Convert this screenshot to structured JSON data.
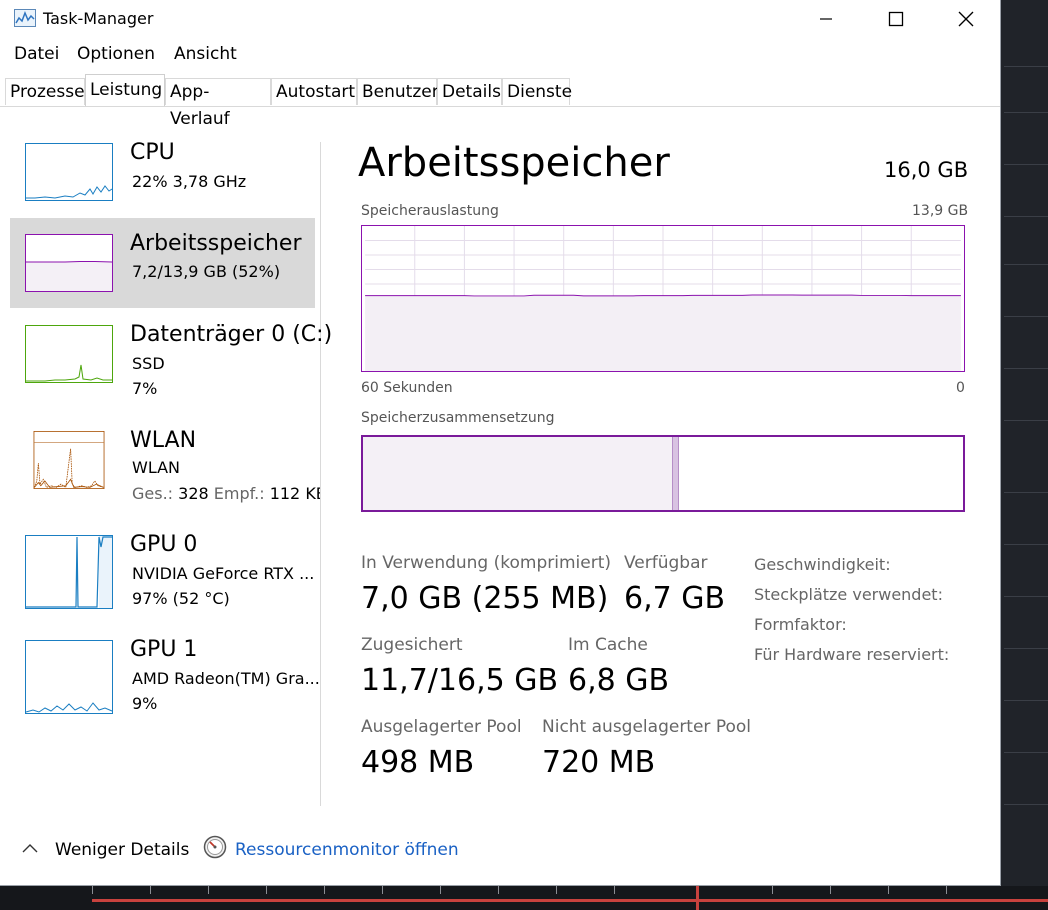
{
  "window": {
    "title": "Task-Manager"
  },
  "menu": [
    "Datei",
    "Optionen",
    "Ansicht"
  ],
  "tabs": [
    "Prozesse",
    "Leistung",
    "App-Verlauf",
    "Autostart",
    "Benutzer",
    "Details",
    "Dienste"
  ],
  "active_tab": "Leistung",
  "sidebar": {
    "items": [
      {
        "title": "CPU",
        "line1": "22%  3,78 GHz",
        "line2": "",
        "color": "#1a7ec2"
      },
      {
        "title": "Arbeitsspeicher",
        "line1": "7,2/13,9 GB (52%)",
        "line2": "",
        "color": "#8b12ae"
      },
      {
        "title": "Datenträger 0 (C:)",
        "line1": "SSD",
        "line2": "7%",
        "color": "#4da60c"
      },
      {
        "title": "WLAN",
        "line1": "WLAN",
        "line2_label_a": "Ges.:",
        "line2_value_a": "328",
        "line2_label_b": "Empf.:",
        "line2_value_b": "112 KB",
        "color": "#a74f01"
      },
      {
        "title": "GPU 0",
        "line1": "NVIDIA GeForce RTX ...",
        "line2": "97%  (52 °C)",
        "color": "#1a7ec2"
      },
      {
        "title": "GPU 1",
        "line1": "AMD Radeon(TM) Gra...",
        "line2": "9%",
        "color": "#1a7ec2"
      }
    ]
  },
  "main": {
    "title": "Arbeitsspeicher",
    "total": "16,0 GB",
    "usage_label": "Speicherauslastung",
    "usage_max": "13,9 GB",
    "time_left": "60 Sekunden",
    "time_right": "0",
    "usage_fraction": 0.52,
    "composition_label": "Speicherzusammensetzung",
    "composition_in_use_fraction": 0.515,
    "stats": [
      {
        "label": "In Verwendung (komprimiert)",
        "value": "7,0 GB (255 MB)"
      },
      {
        "label": "Verfügbar",
        "value": "6,7 GB"
      },
      {
        "label": "Zugesichert",
        "value": "11,7/16,5 GB"
      },
      {
        "label": "Im Cache",
        "value": "6,8 GB"
      },
      {
        "label": "Ausgelagerter Pool",
        "value": "498 MB"
      },
      {
        "label": "Nicht ausgelagerter Pool",
        "value": "720 MB"
      }
    ],
    "right_labels": [
      "Geschwindigkeit:",
      "Steckplätze verwendet:",
      "Formfaktor:",
      "Für Hardware reserviert:"
    ]
  },
  "footer": {
    "less_details": "Weniger Details",
    "resource_monitor": "Ressourcenmonitor öffnen"
  },
  "colors": {
    "memory": "#8b12ae",
    "link": "#1a61c4",
    "selected_bg": "#d9d9d9"
  }
}
